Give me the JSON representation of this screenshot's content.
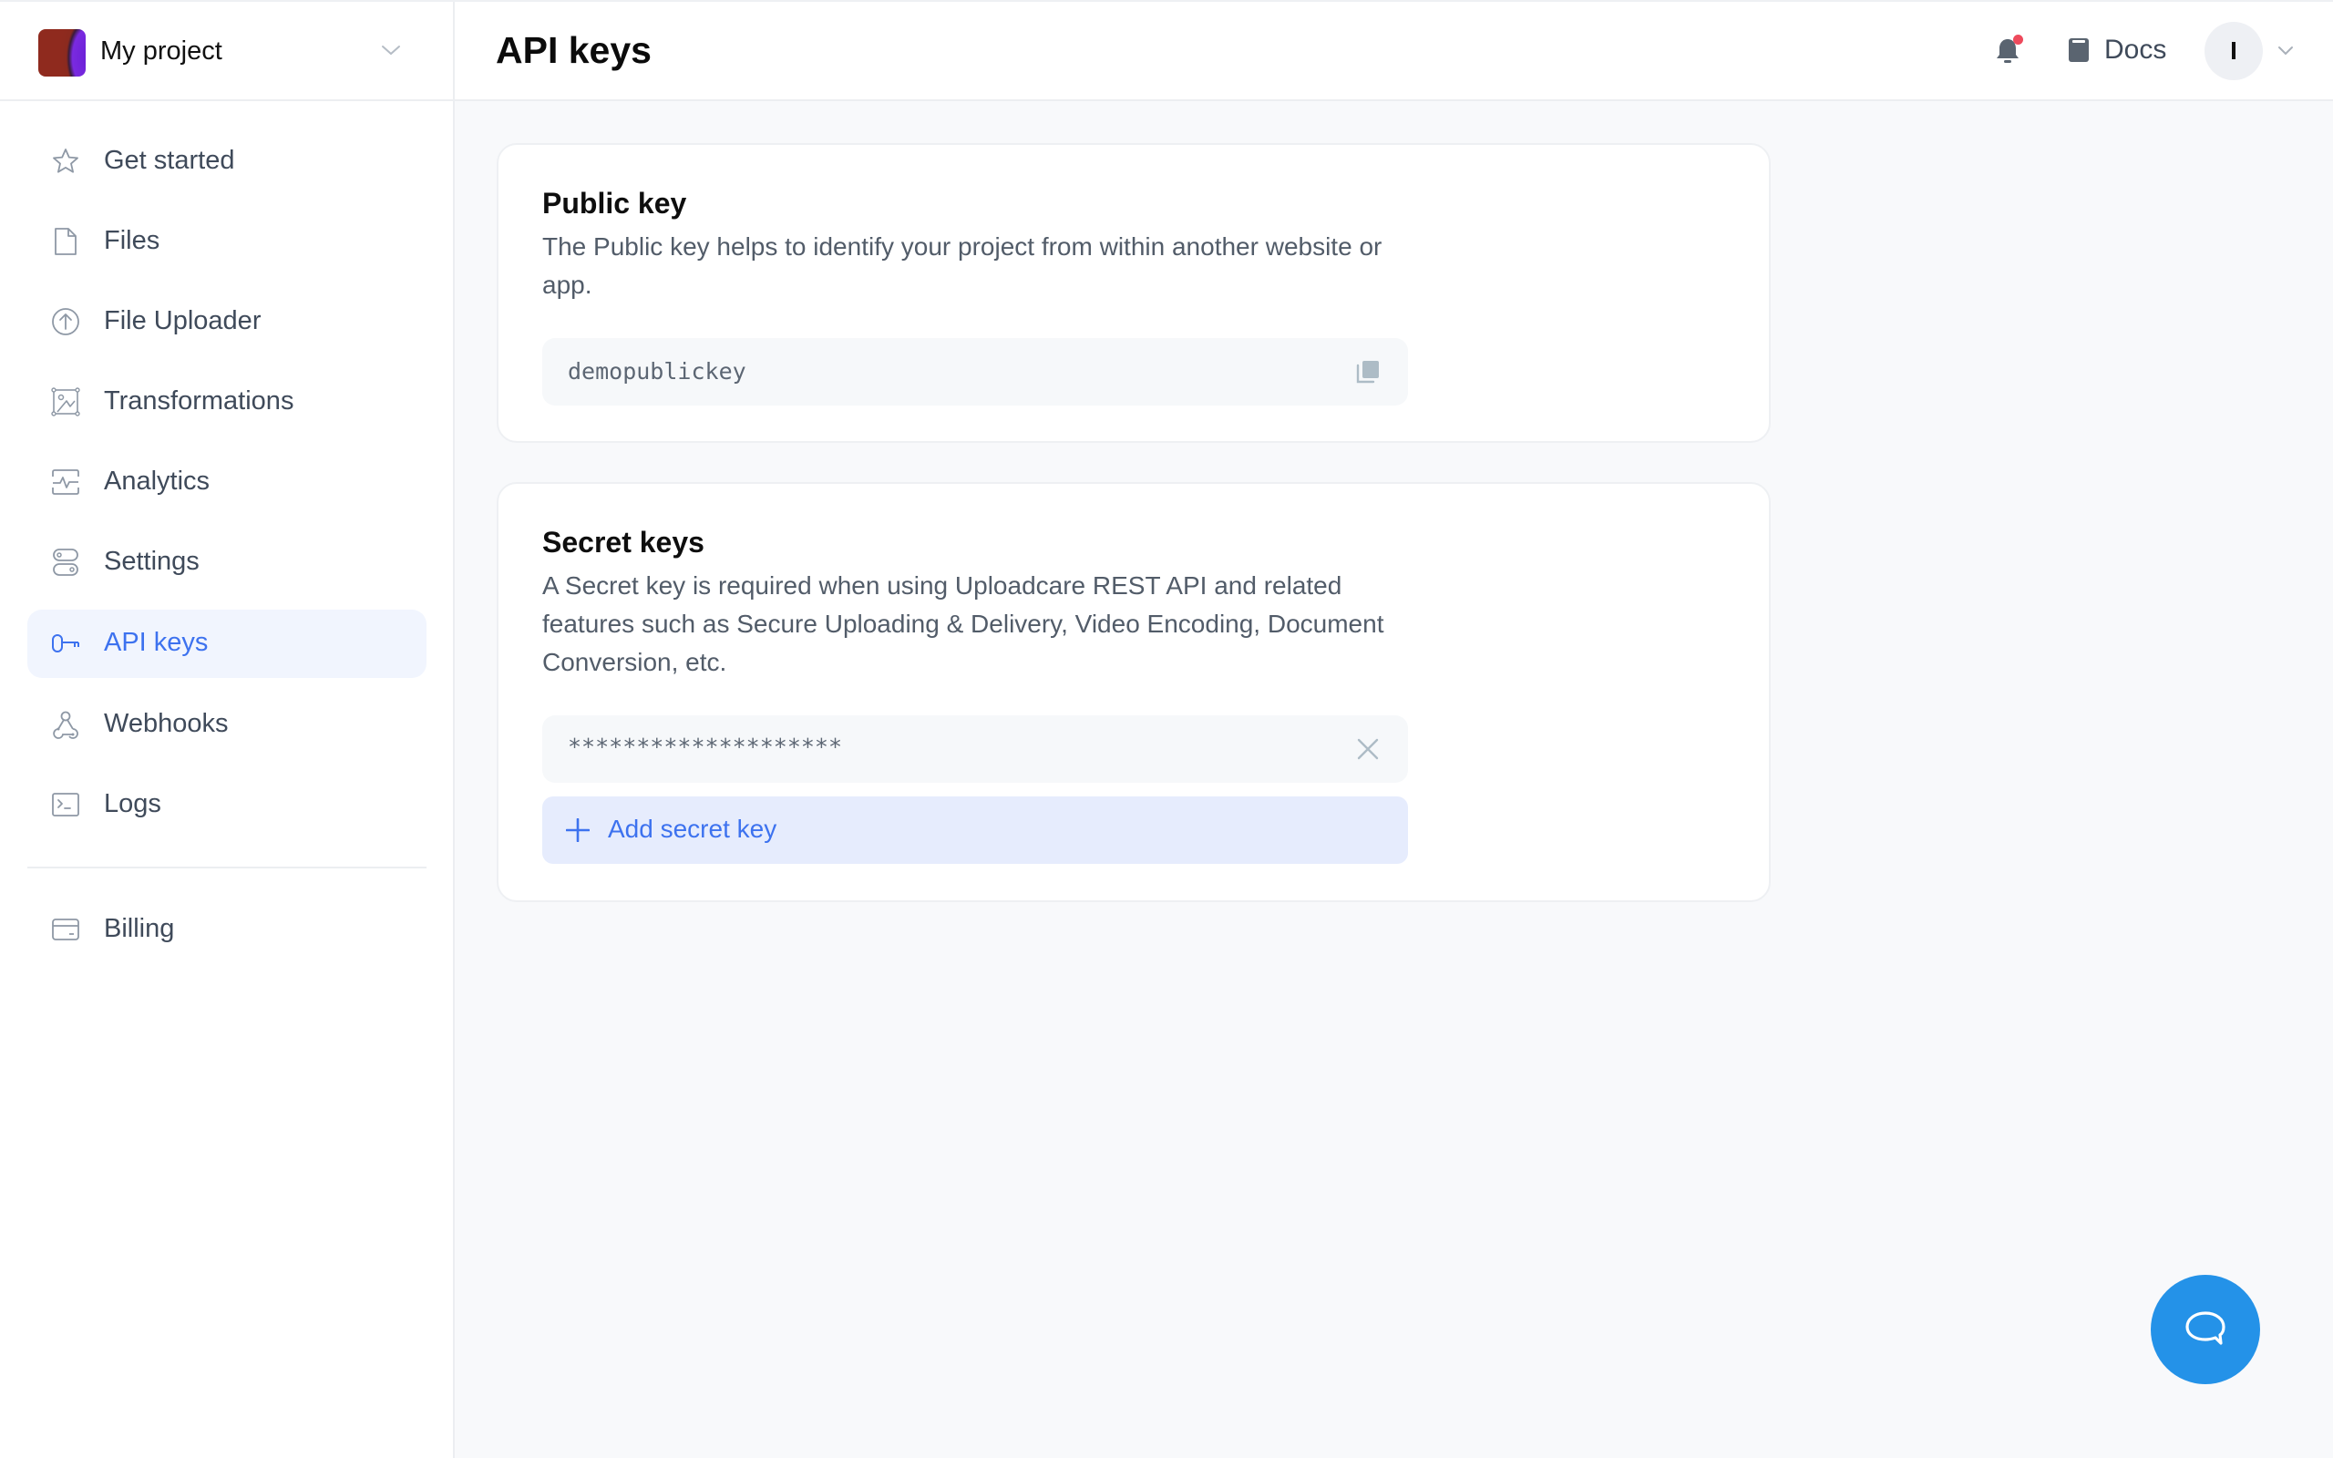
{
  "project": {
    "name": "My project",
    "logo": "project-logo-gradient"
  },
  "sidebar": {
    "items": [
      {
        "label": "Get started",
        "icon": "star-icon",
        "active": false
      },
      {
        "label": "Files",
        "icon": "file-icon",
        "active": false
      },
      {
        "label": "File Uploader",
        "icon": "upload-circle-icon",
        "active": false
      },
      {
        "label": "Transformations",
        "icon": "image-transform-icon",
        "active": false
      },
      {
        "label": "Analytics",
        "icon": "pulse-icon",
        "active": false
      },
      {
        "label": "Settings",
        "icon": "toggles-icon",
        "active": false
      },
      {
        "label": "API keys",
        "icon": "key-icon",
        "active": true
      },
      {
        "label": "Webhooks",
        "icon": "webhook-icon",
        "active": false
      },
      {
        "label": "Logs",
        "icon": "terminal-icon",
        "active": false
      }
    ],
    "secondary_items": [
      {
        "label": "Billing",
        "icon": "credit-card-icon",
        "active": false
      }
    ]
  },
  "header": {
    "title": "API keys",
    "notifications_icon": "bell-icon",
    "has_unread_notifications": true,
    "docs_label": "Docs",
    "docs_icon": "book-icon",
    "avatar_initial": "I"
  },
  "public_key": {
    "title": "Public key",
    "description": "The Public key helps to identify your project from within another website or app.",
    "value": "demopublickey",
    "action_icon": "copy-icon"
  },
  "secret_keys": {
    "title": "Secret keys",
    "description": "A Secret key is required when using Uploadcare REST API and related features such as Secure Uploading & Delivery, Video Encoding, Document Conversion, etc.",
    "keys": [
      {
        "value": "********************",
        "action_icon": "close-icon"
      }
    ],
    "add_label": "Add secret key"
  },
  "chat": {
    "icon": "chat-bubble-icon"
  },
  "colors": {
    "accent": "#3d72ef",
    "active_nav_bg": "#f1f5fe",
    "add_button_bg": "#e6ecfd",
    "chat_button": "#2492e8",
    "notification_dot": "#ee4a5c",
    "page_bg": "#f8f9fb"
  }
}
